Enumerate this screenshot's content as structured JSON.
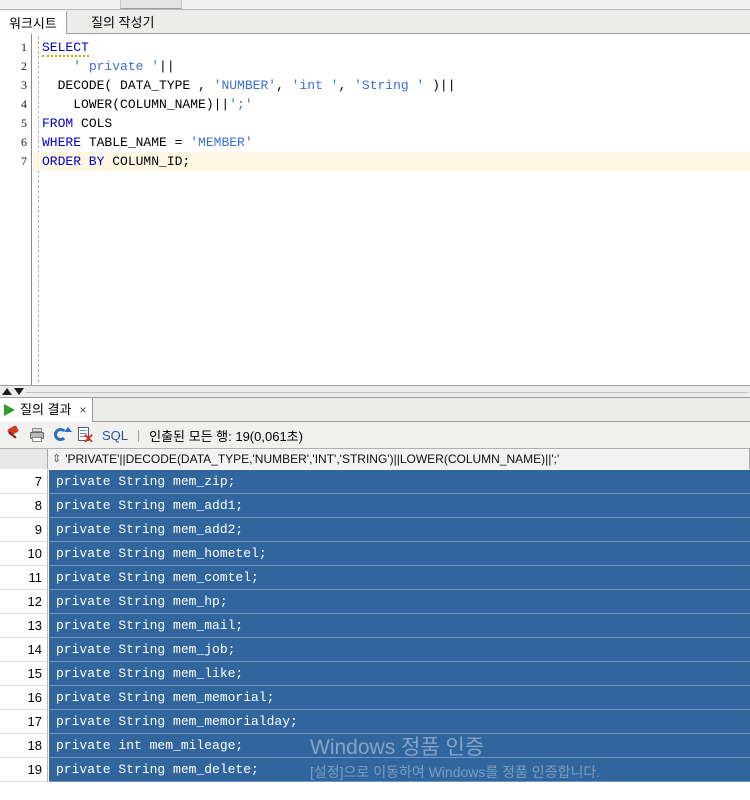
{
  "editor_tabs": [
    {
      "label": "워크시트",
      "active": true
    },
    {
      "label": "질의 작성기",
      "active": false
    }
  ],
  "code": {
    "lines": [
      {
        "num": "1",
        "current": false,
        "tokens": [
          {
            "t": "SELECT",
            "c": "kw",
            "squiggle": true
          }
        ]
      },
      {
        "num": "2",
        "current": false,
        "tokens": [
          {
            "t": "    ",
            "c": "plain"
          },
          {
            "t": "' private '",
            "c": "str"
          },
          {
            "t": "||",
            "c": "plain"
          }
        ]
      },
      {
        "num": "3",
        "current": false,
        "tokens": [
          {
            "t": "  DECODE( DATA_TYPE , ",
            "c": "plain"
          },
          {
            "t": "'NUMBER'",
            "c": "str"
          },
          {
            "t": ", ",
            "c": "plain"
          },
          {
            "t": "'int '",
            "c": "str"
          },
          {
            "t": ", ",
            "c": "plain"
          },
          {
            "t": "'String '",
            "c": "str"
          },
          {
            "t": " )||",
            "c": "plain"
          }
        ]
      },
      {
        "num": "4",
        "current": false,
        "tokens": [
          {
            "t": "    LOWER(COLUMN_NAME)||",
            "c": "plain"
          },
          {
            "t": "';'",
            "c": "str"
          }
        ]
      },
      {
        "num": "5",
        "current": false,
        "tokens": [
          {
            "t": "FROM",
            "c": "kw"
          },
          {
            "t": " COLS",
            "c": "plain"
          }
        ]
      },
      {
        "num": "6",
        "current": false,
        "tokens": [
          {
            "t": "WHERE",
            "c": "kw"
          },
          {
            "t": " TABLE_NAME = ",
            "c": "plain"
          },
          {
            "t": "'MEMBER'",
            "c": "str"
          }
        ]
      },
      {
        "num": "7",
        "current": true,
        "tokens": [
          {
            "t": "ORDER BY",
            "c": "kw"
          },
          {
            "t": " COLUMN_ID;",
            "c": "plain"
          }
        ]
      }
    ],
    "empty_gutter_numbers": []
  },
  "results": {
    "tab_label": "질의 결과",
    "tab_close": "×",
    "toolbar": {
      "icons": [
        "pin-icon",
        "print-icon",
        "refresh-icon",
        "clear-icon"
      ],
      "sql_label": "SQL",
      "separator": "|",
      "rows_fetched": "인출된 모든 행: 19(0,061초)"
    },
    "column_header": "'PRIVATE'||DECODE(DATA_TYPE,'NUMBER','INT','STRING')||LOWER(COLUMN_NAME)||';'",
    "sort_glyph": "⇕",
    "rows": [
      {
        "num": "7",
        "value": "private String mem_zip;"
      },
      {
        "num": "8",
        "value": "private String mem_add1;"
      },
      {
        "num": "9",
        "value": "private String mem_add2;"
      },
      {
        "num": "10",
        "value": "private String mem_hometel;"
      },
      {
        "num": "11",
        "value": "private String mem_comtel;"
      },
      {
        "num": "12",
        "value": "private String mem_hp;"
      },
      {
        "num": "13",
        "value": "private String mem_mail;"
      },
      {
        "num": "14",
        "value": "private String mem_job;"
      },
      {
        "num": "15",
        "value": "private String mem_like;"
      },
      {
        "num": "16",
        "value": "private String mem_memorial;"
      },
      {
        "num": "17",
        "value": "private String mem_memorialday;"
      },
      {
        "num": "18",
        "value": "private int mem_mileage;"
      },
      {
        "num": "19",
        "value": "private String mem_delete;"
      }
    ]
  },
  "watermark": {
    "title": "Windows 정품 인증",
    "subtitle": "[설정]으로 이동하여 Windows를 정품 인증합니다."
  },
  "colors": {
    "selection_blue": "#31659e",
    "keyword_blue": "#0000c8",
    "string_blue": "#3a6fd8",
    "current_line": "#fdf6e3"
  }
}
